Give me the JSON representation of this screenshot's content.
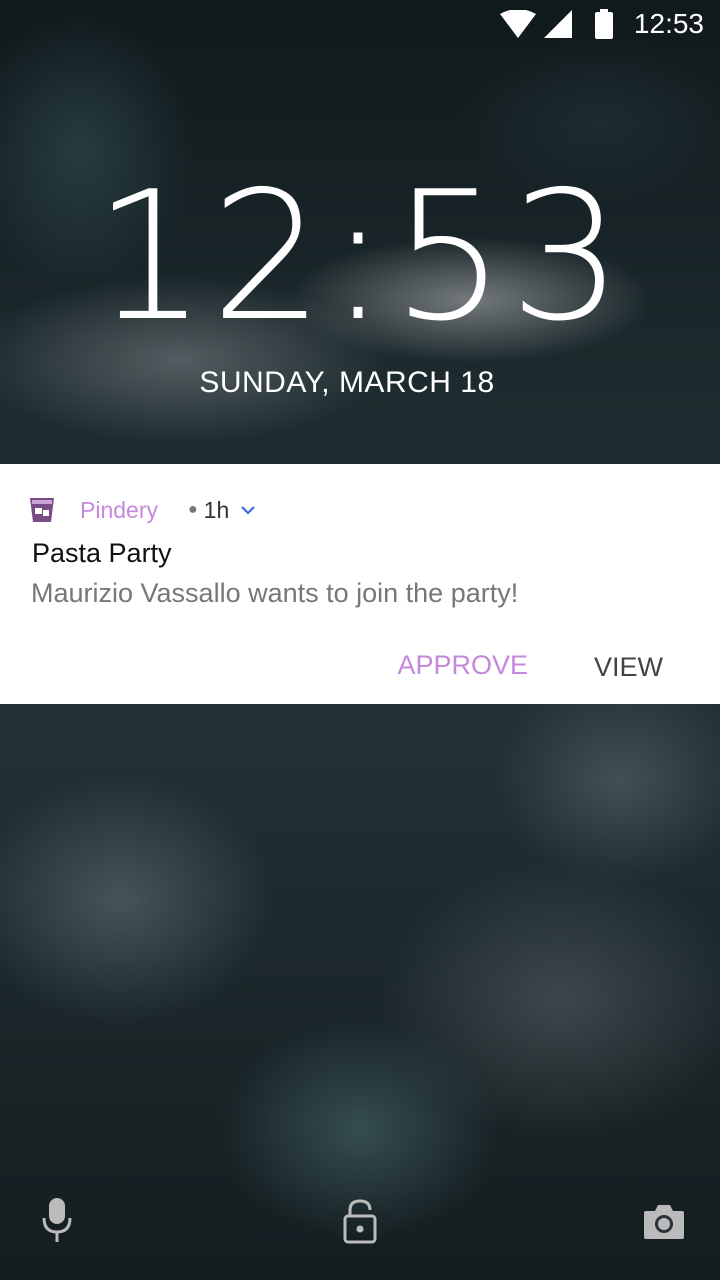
{
  "status_bar": {
    "time": "12:53",
    "icons": [
      "wifi-icon",
      "signal-icon",
      "battery-icon"
    ]
  },
  "lock_screen": {
    "clock": "12:53",
    "date": "SUNDAY, MARCH 18"
  },
  "notification": {
    "app_icon": "pindery-app-icon",
    "app_name": "Pindery",
    "time_ago": "1h",
    "title": "Pasta Party",
    "text": "Maurizio Vassallo wants to join the party!",
    "actions": {
      "approve": "APPROVE",
      "view": "VIEW"
    },
    "colors": {
      "accent": "#c687dd",
      "expand": "#3f6bd6"
    }
  },
  "bottom_shortcuts": [
    "microphone-icon",
    "lock-icon",
    "camera-icon"
  ]
}
